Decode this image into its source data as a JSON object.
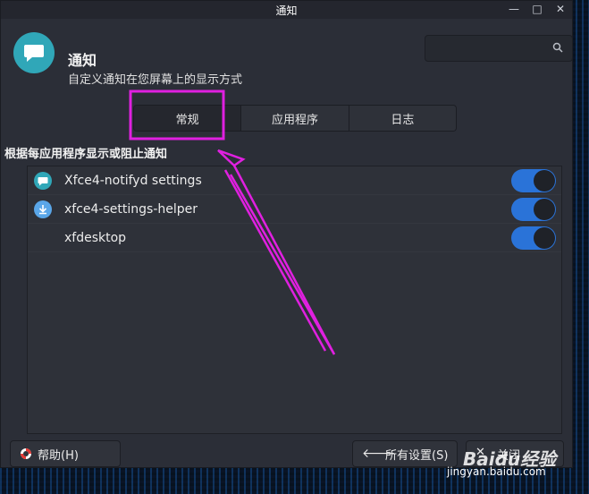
{
  "window": {
    "title": "通知",
    "controls": [
      "—",
      "□",
      "✕"
    ]
  },
  "header": {
    "title": "通知",
    "subtitle": "自定义通知在您屏幕上的显示方式",
    "search_placeholder": ""
  },
  "tabs": [
    {
      "label": "常规",
      "active": true
    },
    {
      "label": "应用程序",
      "active": false
    },
    {
      "label": "日志",
      "active": false
    }
  ],
  "section_label": "根据每应用程序显示或阻止通知",
  "apps": [
    {
      "name": "Xfce4-notifyd settings",
      "icon": "chat-bubble-icon",
      "enabled": true
    },
    {
      "name": "xfce4-settings-helper",
      "icon": "download-icon",
      "enabled": true
    },
    {
      "name": "xfdesktop",
      "icon": "none",
      "enabled": true
    }
  ],
  "buttons": {
    "help": "帮助(H)",
    "all_settings": "所有设置(S)",
    "close": "关闭"
  },
  "watermark": {
    "logo": "Baidu经验",
    "url": "jingyan.baidu.com"
  },
  "colors": {
    "accent": "#2a73d8",
    "app_icon": "#30a7b8",
    "annotation": "#e020e0"
  }
}
